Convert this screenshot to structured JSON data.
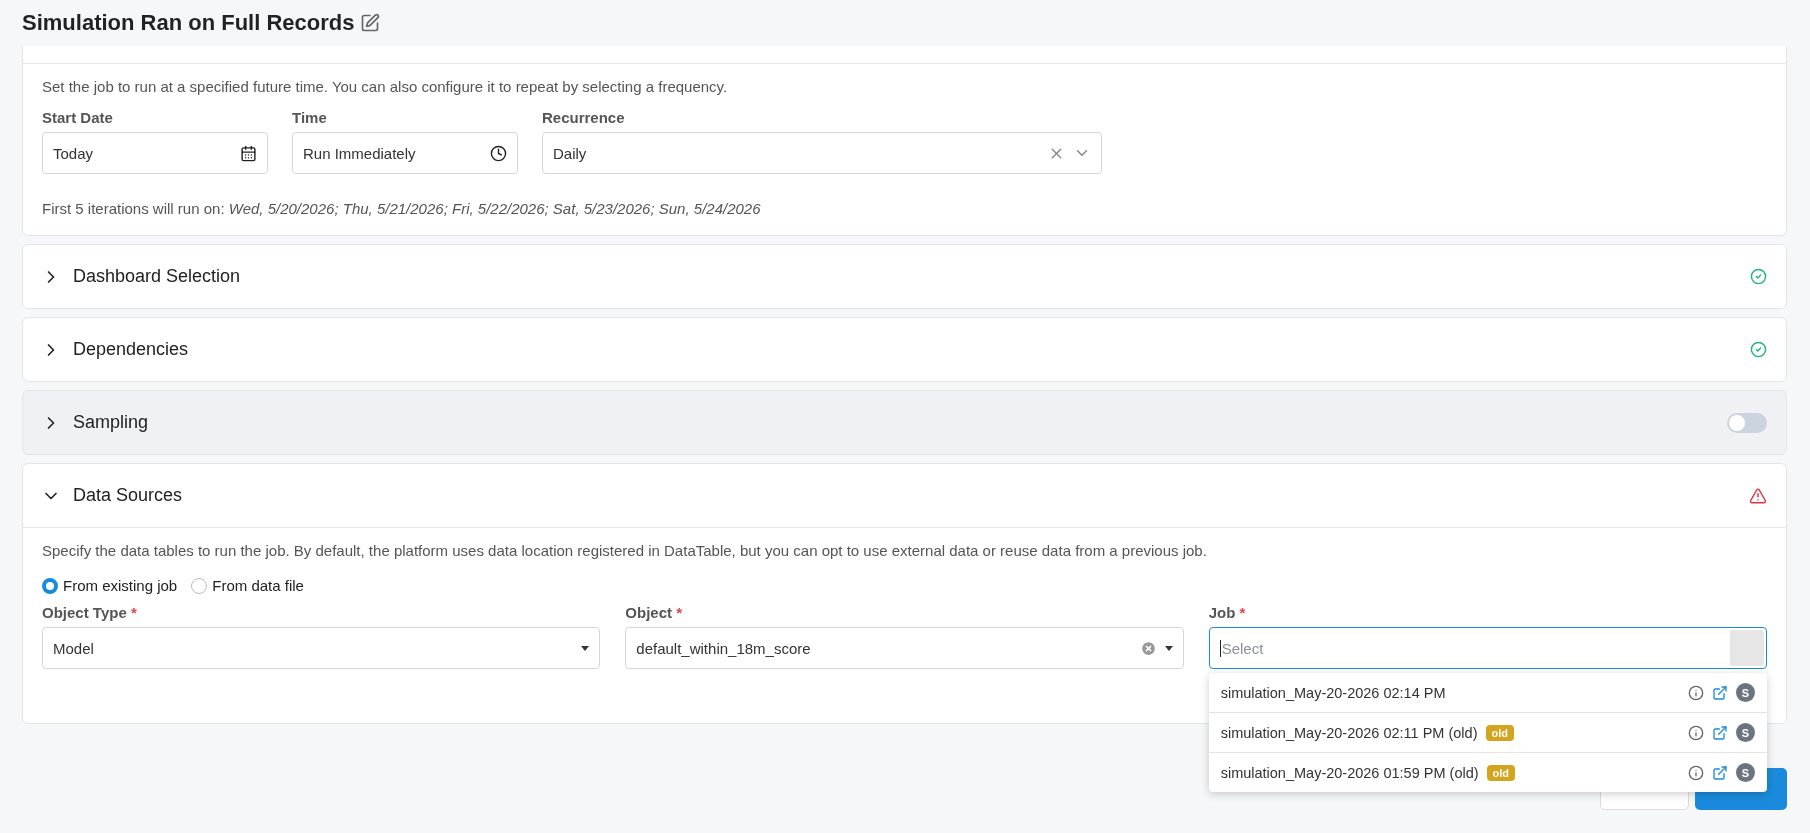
{
  "page": {
    "title": "Simulation Ran on Full Records"
  },
  "schedule": {
    "description": "Set the job to run at a specified future time. You can also configure it to repeat by selecting a frequency.",
    "fields": [
      {
        "label": "Start Date",
        "value": "Today",
        "kind": "date"
      },
      {
        "label": "Time",
        "value": "Run Immediately",
        "kind": "time"
      },
      {
        "label": "Recurrence",
        "value": "Daily",
        "kind": "select"
      }
    ],
    "iterations_label": "First 5 iterations will run on:",
    "iterations": "Wed, 5/20/2026; Thu, 5/21/2026; Fri, 5/22/2026; Sat, 5/23/2026; Sun, 5/24/2026"
  },
  "sections": [
    {
      "title": "Dashboard Selection",
      "expanded": false,
      "kind": "check"
    },
    {
      "title": "Dependencies",
      "expanded": false,
      "kind": "check"
    },
    {
      "title": "Sampling",
      "expanded": false,
      "kind": "switch",
      "on": false
    },
    {
      "title": "Data Sources",
      "expanded": true,
      "kind": "warning"
    }
  ],
  "data_sources": {
    "description": "Specify the data tables to run the job. By default, the platform uses data location registered in DataTable, but you can opt to use external data or reuse data from a previous job.",
    "radios": [
      {
        "label": "From existing job",
        "selected": true
      },
      {
        "label": "From data file",
        "selected": false
      }
    ],
    "object_type": {
      "label": "Object Type",
      "required_mark": "*",
      "value": "Model"
    },
    "object": {
      "label": "Object",
      "required_mark": "*",
      "value": "default_within_18m_score"
    },
    "job": {
      "label": "Job",
      "required_mark": "*",
      "placeholder": "Select",
      "options": [
        {
          "label": "simulation_May-20-2026 02:14 PM",
          "avatar": "S"
        },
        {
          "label": "simulation_May-20-2026 02:11 PM (old)",
          "badge": "old",
          "avatar": "S"
        },
        {
          "label": "simulation_May-20-2026 01:59 PM (old)",
          "badge": "old",
          "avatar": "S"
        }
      ]
    }
  }
}
